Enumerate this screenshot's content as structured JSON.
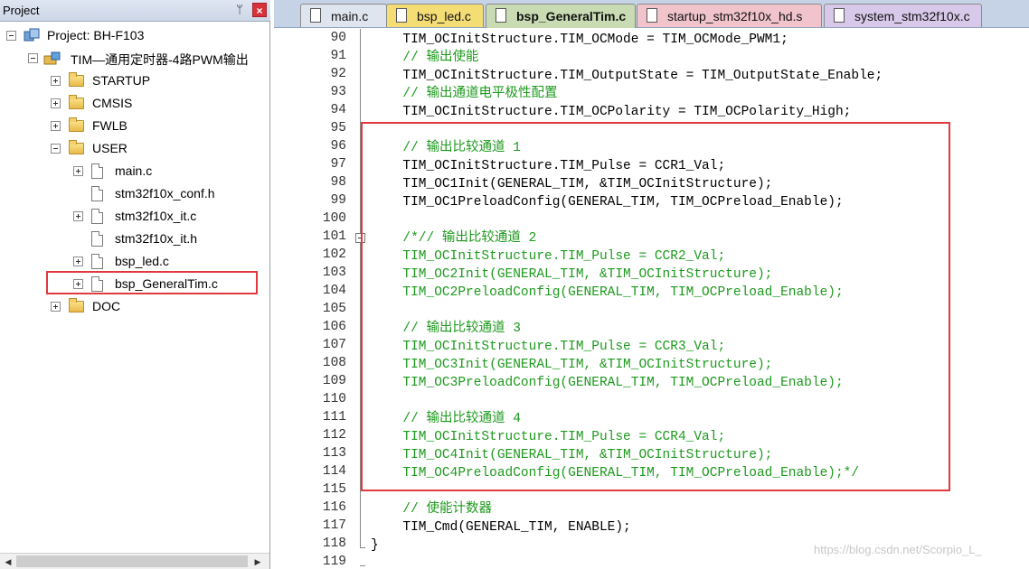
{
  "project_panel": {
    "title": "Project",
    "pin_glyph": "ᛘ",
    "close_glyph": "×",
    "tree": [
      {
        "label": "Project: BH-F103",
        "icon": "project-icon",
        "expander": "minus"
      },
      {
        "label": "TIM—通用定时器-4路PWM输出",
        "icon": "target-icon",
        "expander": "minus"
      },
      {
        "label": "STARTUP",
        "icon": "folder-icon",
        "expander": "plus"
      },
      {
        "label": "CMSIS",
        "icon": "folder-icon",
        "expander": "plus"
      },
      {
        "label": "FWLB",
        "icon": "folder-icon",
        "expander": "plus"
      },
      {
        "label": "USER",
        "icon": "folder-icon",
        "expander": "minus"
      },
      {
        "label": "main.c",
        "icon": "file-icon",
        "expander": "plus"
      },
      {
        "label": "stm32f10x_conf.h",
        "icon": "file-icon",
        "expander": "none"
      },
      {
        "label": "stm32f10x_it.c",
        "icon": "file-icon",
        "expander": "plus"
      },
      {
        "label": "stm32f10x_it.h",
        "icon": "file-icon",
        "expander": "none"
      },
      {
        "label": "bsp_led.c",
        "icon": "file-icon",
        "expander": "plus"
      },
      {
        "label": "bsp_GeneralTim.c",
        "icon": "file-icon",
        "expander": "plus"
      },
      {
        "label": "DOC",
        "icon": "folder-icon",
        "expander": "plus"
      }
    ]
  },
  "tabs": [
    {
      "label": "main.c",
      "color": "#dfe5ee",
      "active": false
    },
    {
      "label": "bsp_led.c",
      "color": "#f5dd76",
      "active": false
    },
    {
      "label": "bsp_GeneralTim.c",
      "color": "#c8dbb3",
      "active": true
    },
    {
      "label": "startup_stm32f10x_hd.s",
      "color": "#f1c4cc",
      "active": false
    },
    {
      "label": "system_stm32f10x.c",
      "color": "#d8c8ea",
      "active": false
    }
  ],
  "code": [
    {
      "num": "90",
      "text": "  TIM_OCInitStructure.TIM_OCMode = TIM_OCMode_PWM1;",
      "style": "normal"
    },
    {
      "num": "91",
      "text": "  // 输出使能",
      "style": "comment"
    },
    {
      "num": "92",
      "text": "  TIM_OCInitStructure.TIM_OutputState = TIM_OutputState_Enable;",
      "style": "normal"
    },
    {
      "num": "93",
      "text": "  // 输出通道电平极性配置",
      "style": "comment"
    },
    {
      "num": "94",
      "text": "  TIM_OCInitStructure.TIM_OCPolarity = TIM_OCPolarity_High;",
      "style": "normal"
    },
    {
      "num": "95",
      "text": "",
      "style": "normal"
    },
    {
      "num": "96",
      "text": "  // 输出比较通道 1",
      "style": "comment"
    },
    {
      "num": "97",
      "text": "  TIM_OCInitStructure.TIM_Pulse = CCR1_Val;",
      "style": "normal"
    },
    {
      "num": "98",
      "text": "  TIM_OC1Init(GENERAL_TIM, &TIM_OCInitStructure);",
      "style": "normal"
    },
    {
      "num": "99",
      "text": "  TIM_OC1PreloadConfig(GENERAL_TIM, TIM_OCPreload_Enable);",
      "style": "normal"
    },
    {
      "num": "100",
      "text": "",
      "style": "normal"
    },
    {
      "num": "101",
      "text": "  /*// 输出比较通道 2",
      "style": "comment"
    },
    {
      "num": "102",
      "text": "  TIM_OCInitStructure.TIM_Pulse = CCR2_Val;",
      "style": "comment"
    },
    {
      "num": "103",
      "text": "  TIM_OC2Init(GENERAL_TIM, &TIM_OCInitStructure);",
      "style": "comment"
    },
    {
      "num": "104",
      "text": "  TIM_OC2PreloadConfig(GENERAL_TIM, TIM_OCPreload_Enable);",
      "style": "comment"
    },
    {
      "num": "105",
      "text": "",
      "style": "comment"
    },
    {
      "num": "106",
      "text": "  // 输出比较通道 3",
      "style": "comment"
    },
    {
      "num": "107",
      "text": "  TIM_OCInitStructure.TIM_Pulse = CCR3_Val;",
      "style": "comment"
    },
    {
      "num": "108",
      "text": "  TIM_OC3Init(GENERAL_TIM, &TIM_OCInitStructure);",
      "style": "comment"
    },
    {
      "num": "109",
      "text": "  TIM_OC3PreloadConfig(GENERAL_TIM, TIM_OCPreload_Enable);",
      "style": "comment"
    },
    {
      "num": "110",
      "text": "",
      "style": "comment"
    },
    {
      "num": "111",
      "text": "  // 输出比较通道 4",
      "style": "comment"
    },
    {
      "num": "112",
      "text": "  TIM_OCInitStructure.TIM_Pulse = CCR4_Val;",
      "style": "comment"
    },
    {
      "num": "113",
      "text": "  TIM_OC4Init(GENERAL_TIM, &TIM_OCInitStructure);",
      "style": "comment"
    },
    {
      "num": "114",
      "text": "  TIM_OC4PreloadConfig(GENERAL_TIM, TIM_OCPreload_Enable);*/",
      "style": "comment"
    },
    {
      "num": "115",
      "text": "",
      "style": "normal"
    },
    {
      "num": "116",
      "text": "  // 使能计数器",
      "style": "comment"
    },
    {
      "num": "117",
      "text": "  TIM_Cmd(GENERAL_TIM, ENABLE);",
      "style": "normal"
    },
    {
      "num": "118",
      "text": "}",
      "style": "normal"
    },
    {
      "num": "119",
      "text": "",
      "style": "normal"
    }
  ],
  "watermark": "https://blog.csdn.net/Scorpio_L_"
}
